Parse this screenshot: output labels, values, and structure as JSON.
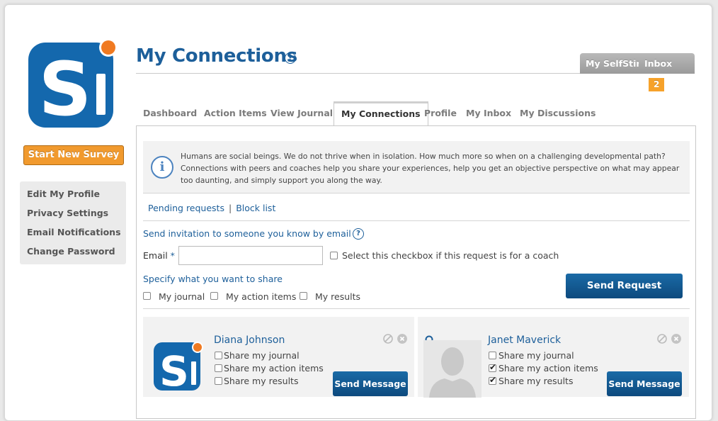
{
  "page": {
    "title": "My Connections"
  },
  "sidebar": {
    "start_button": "Start New Survey",
    "menu": [
      "Edit My Profile",
      "Privacy Settings",
      "Email Notifications",
      "Change Password"
    ]
  },
  "top_tabs": {
    "my_selfstir": "My SelfStir",
    "inbox": "Inbox",
    "inbox_count": "2"
  },
  "nav": {
    "tabs": [
      "Dashboard",
      "Action Items",
      "View Journal",
      "My Connections",
      "Profile",
      "My Inbox",
      "My Discussions"
    ],
    "active": "My Connections"
  },
  "info": {
    "text": "Humans are social beings. We do not thrive when in isolation. How much more so when on a challenging developmental path? Connections with peers and coaches help you share your experiences, help you get an objective perspective on what may appear too daunting, and simply support you along the way."
  },
  "links": {
    "pending": "Pending requests",
    "separator": "|",
    "block": "Block list"
  },
  "invite": {
    "heading": "Send invitation to someone you know by email",
    "email_label": "Email",
    "required_mark": "*",
    "email_value": "",
    "coach_checkbox": "Select this checkbox if this request is for a coach",
    "share_heading": "Specify what you want to share",
    "share_options": [
      "My journal",
      "My action items",
      "My results"
    ],
    "send_button": "Send Request"
  },
  "connections": [
    {
      "name": "Diana Johnson",
      "options": [
        "Share my journal",
        "Share my action items",
        "Share my results"
      ],
      "checked": [
        false,
        false,
        false
      ],
      "button": "Send Message"
    },
    {
      "name": "Janet Maverick",
      "options": [
        "Share my journal",
        "Share my action items",
        "Share my results"
      ],
      "checked": [
        false,
        true,
        true
      ],
      "button": "Send Message"
    }
  ],
  "colors": {
    "brand_blue": "#1d5f9a",
    "accent_orange": "#f19a2e",
    "button_blue": "#0d4a7e"
  }
}
